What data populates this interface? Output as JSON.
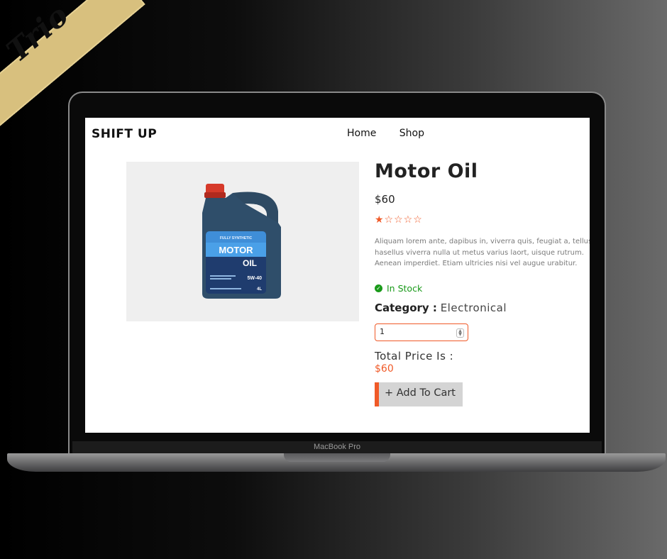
{
  "banner": {
    "text": "Trio"
  },
  "device": {
    "model_label": "MacBook Pro"
  },
  "header": {
    "logo": "SHIFT UP",
    "nav": [
      "Home",
      "Shop"
    ]
  },
  "product": {
    "title": "Motor Oil",
    "price": "$60",
    "rating": {
      "value": 1,
      "max": 5,
      "stars": "★☆☆☆☆"
    },
    "description_lines": [
      "Aliquam lorem ante, dapibus in, viverra quis, feugiat a, tellus",
      "hasellus viverra nulla ut metus varius laort, uisque rutrum.",
      "Aenean imperdiet. Etiam ultricies nisi vel augue urabitur."
    ],
    "stock_status": "In Stock",
    "category_label": "Category :",
    "category_value": "Electronical",
    "quantity": "1",
    "total_label": "Total Price Is :",
    "total_value": "$60",
    "add_to_cart": "Add To Cart",
    "add_icon": "+",
    "bottle": {
      "top_text": "FULLY SYNTHETIC",
      "name_line1": "MOTOR",
      "name_line2": "OIL",
      "grade": "5W-40",
      "volume": "4L"
    }
  },
  "colors": {
    "accent": "#f05a28",
    "stock": "#1a9a1a",
    "banner": "#d8c07e"
  }
}
